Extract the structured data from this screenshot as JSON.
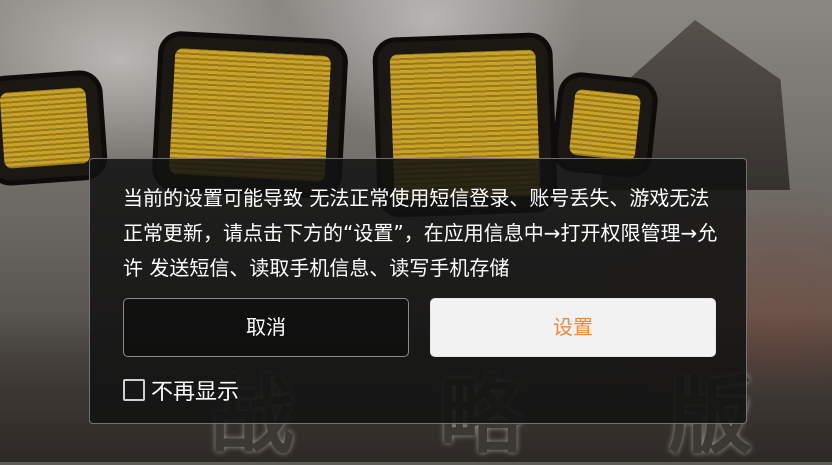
{
  "background": {
    "subtitle_text": "战 略 版",
    "logo_color": "#c9a227"
  },
  "dialog": {
    "message": "当前的设置可能导致 无法正常使用短信登录、账号丢失、游戏无法正常更新，请点击下方的“设置”，在应用信息中→打开权限管理→允许 发送短信、读取手机信息、读写手机存储",
    "cancel_label": "取消",
    "settings_label": "设置",
    "settings_color": "#f0893a",
    "dont_show_label": "不再显示",
    "dont_show_checked": false
  }
}
